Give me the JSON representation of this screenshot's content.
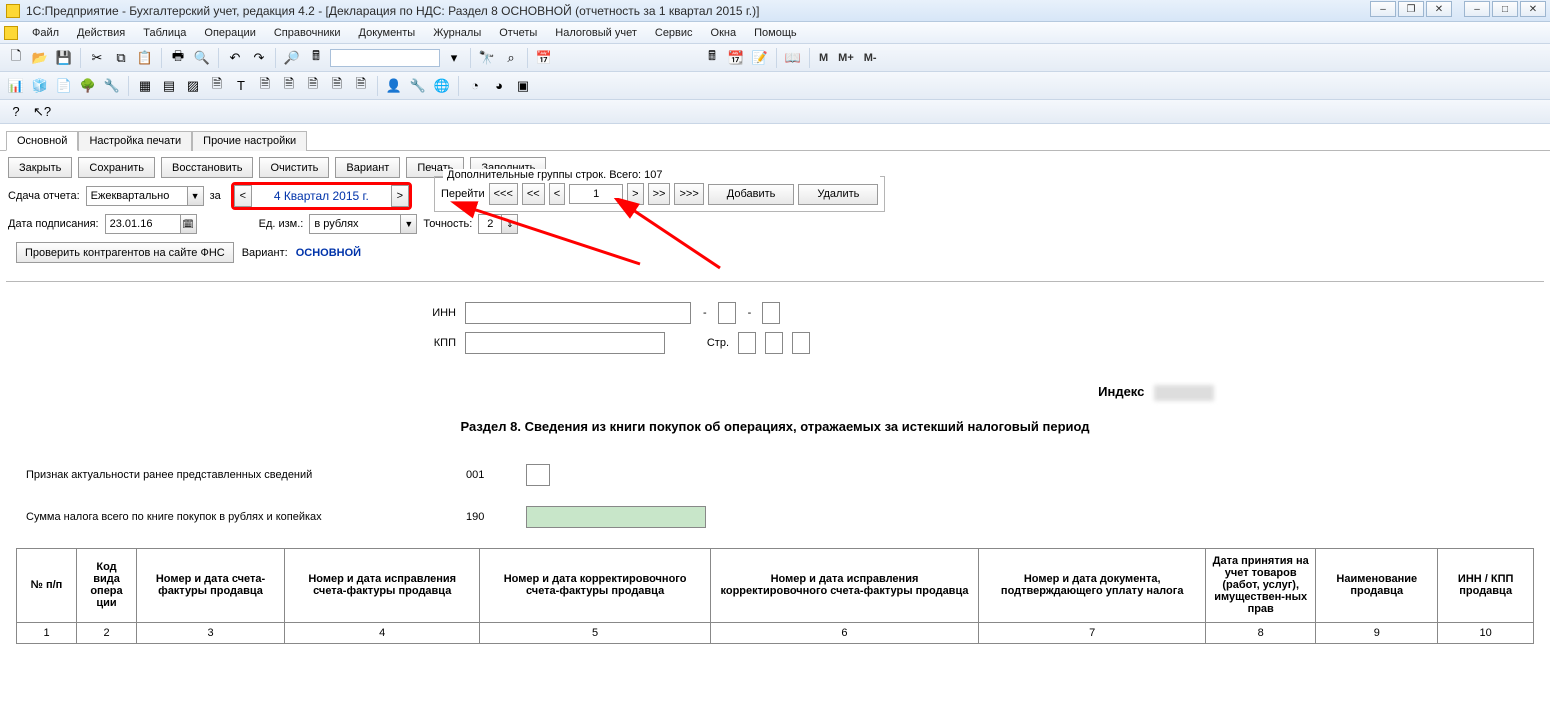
{
  "titlebar": {
    "title": "1С:Предприятие - Бухгалтерский учет, редакция 4.2 - [Декларация по НДС: Раздел 8 ОСНОВНОЙ (отчетность за 1 квартал 2015 г.)]"
  },
  "menu": [
    "Файл",
    "Действия",
    "Таблица",
    "Операции",
    "Справочники",
    "Документы",
    "Журналы",
    "Отчеты",
    "Налоговый учет",
    "Сервис",
    "Окна",
    "Помощь"
  ],
  "toolbar2_text": {
    "m": "M",
    "mplus": "M+",
    "mminus": "M-"
  },
  "tabs": [
    "Основной",
    "Настройка печати",
    "Прочие настройки"
  ],
  "buttons": {
    "close": "Закрыть",
    "save": "Сохранить",
    "restore": "Восстановить",
    "clear": "Очистить",
    "variant": "Вариант",
    "print": "Печать",
    "fill": "Заполнить"
  },
  "params": {
    "sdacha_label": "Сдача отчета:",
    "sdacha_value": "Ежеквартально",
    "za": "за",
    "period": "4 Квартал 2015 г.",
    "sign_date_label": "Дата подписания:",
    "sign_date": "23.01.16",
    "unit_label": "Ед. изм.:",
    "unit_value": "в рублях",
    "precision_label": "Точность:",
    "precision_value": "2",
    "check_btn": "Проверить контрагентов на сайте ФНС",
    "variant_label": "Вариант:",
    "variant_value": "ОСНОВНОЙ"
  },
  "group": {
    "legend": "Дополнительные группы строк. Всего: 107",
    "goto": "Перейти",
    "page": "1",
    "add": "Добавить",
    "delete": "Удалить"
  },
  "doc": {
    "inn": "ИНН",
    "kpp": "КПП",
    "page": "Стр.",
    "index": "Индекс",
    "section_title": "Раздел 8. Сведения из книги покупок об операциях, отражаемых за истекший налоговый период",
    "row1_descr": "Признак актуальности ранее представленных сведений",
    "row1_code": "001",
    "row2_descr": "Сумма налога всего по книге покупок в рублях и копейках",
    "row2_code": "190"
  },
  "table": {
    "headers": [
      "№ п/п",
      "Код вида опера ции",
      "Номер и дата счета-фактуры продавца",
      "Номер и дата исправления счета-фактуры продавца",
      "Номер и дата корректировочного счета-фактуры продавца",
      "Номер и дата исправления корректировочного счета-фактуры продавца",
      "Номер и дата документа, подтверждающего уплату налога",
      "Дата принятия на учет товаров (работ, услуг), имуществен-ных прав",
      "Наименование продавца",
      "ИНН / КПП продавца"
    ],
    "nums": [
      "1",
      "2",
      "3",
      "4",
      "5",
      "6",
      "7",
      "8",
      "9",
      "10"
    ]
  }
}
